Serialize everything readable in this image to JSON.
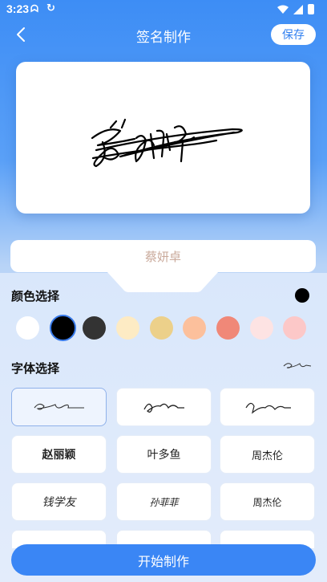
{
  "status_bar": {
    "time": "3:23",
    "icon_a": "ᗣ",
    "icon_b": "↻"
  },
  "header": {
    "title": "签名制作",
    "save_label": "保存"
  },
  "signature_canvas": {
    "signature_text": "蔡妍卓",
    "ink_color": "#000000"
  },
  "name_input": {
    "value": "蔡妍卓"
  },
  "color_section": {
    "title": "颜色选择",
    "current_color": "#000000",
    "swatches": [
      "#ffffff",
      "#000000",
      "#333333",
      "#fdebc4",
      "#ecd08a",
      "#fcc09c",
      "#f08878",
      "#fde3e3",
      "#fcc8c8"
    ],
    "selected_index": 1
  },
  "font_section": {
    "title": "字体选择",
    "items": [
      {
        "label": "",
        "kind": "signature"
      },
      {
        "label": "",
        "kind": "signature"
      },
      {
        "label": "",
        "kind": "signature"
      },
      {
        "label": "赵丽颖",
        "kind": "text"
      },
      {
        "label": "叶多鱼",
        "kind": "text"
      },
      {
        "label": "周杰伦",
        "kind": "text"
      },
      {
        "label": "钱学友",
        "kind": "text"
      },
      {
        "label": "孙菲菲",
        "kind": "text"
      },
      {
        "label": "周杰伦",
        "kind": "text"
      },
      {
        "label": "",
        "kind": "text"
      },
      {
        "label": "",
        "kind": "text"
      },
      {
        "label": "",
        "kind": "text"
      }
    ],
    "selected_index": 0
  },
  "start_button": {
    "label": "开始制作"
  }
}
